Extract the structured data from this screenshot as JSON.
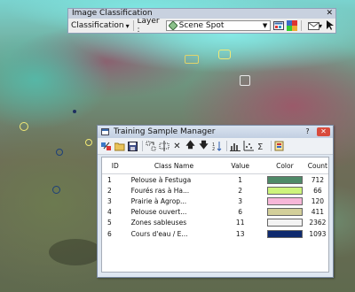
{
  "toolbar": {
    "title": "Image Classification",
    "close_glyph": "✕",
    "classification_label": "Classification",
    "dropdown_glyph": "▾",
    "layer_label": "Layer :",
    "layer_value": "Scene Spot",
    "combo_arrow_glyph": "▼"
  },
  "window": {
    "title": "Training Sample Manager",
    "help_glyph": "?",
    "close_glyph": "✕",
    "tool_glyphs": {
      "delete": "✕",
      "move_up": "🡅",
      "move_down": "🡇",
      "sort": "↓"
    }
  },
  "table": {
    "columns": [
      "ID",
      "Class Name",
      "Value",
      "Color",
      "Count"
    ],
    "rows": [
      {
        "id": "1",
        "name": "Pelouse à Festuga",
        "value": "1",
        "color": "#4f8a68",
        "count": "712"
      },
      {
        "id": "2",
        "name": "Fourés ras à Ha...",
        "value": "2",
        "color": "#cdf47c",
        "count": "66"
      },
      {
        "id": "3",
        "name": "Prairie à Agrop...",
        "value": "3",
        "color": "#f7b7d8",
        "count": "120"
      },
      {
        "id": "4",
        "name": "Pelouse ouvert...",
        "value": "6",
        "color": "#d3cf9a",
        "count": "411"
      },
      {
        "id": "5",
        "name": "Zones sableuses",
        "value": "11",
        "color": "#f3f3f3",
        "count": "2362"
      },
      {
        "id": "6",
        "name": "Cours d'eau / E...",
        "value": "13",
        "color": "#0f2a6e",
        "count": "1093"
      }
    ]
  }
}
